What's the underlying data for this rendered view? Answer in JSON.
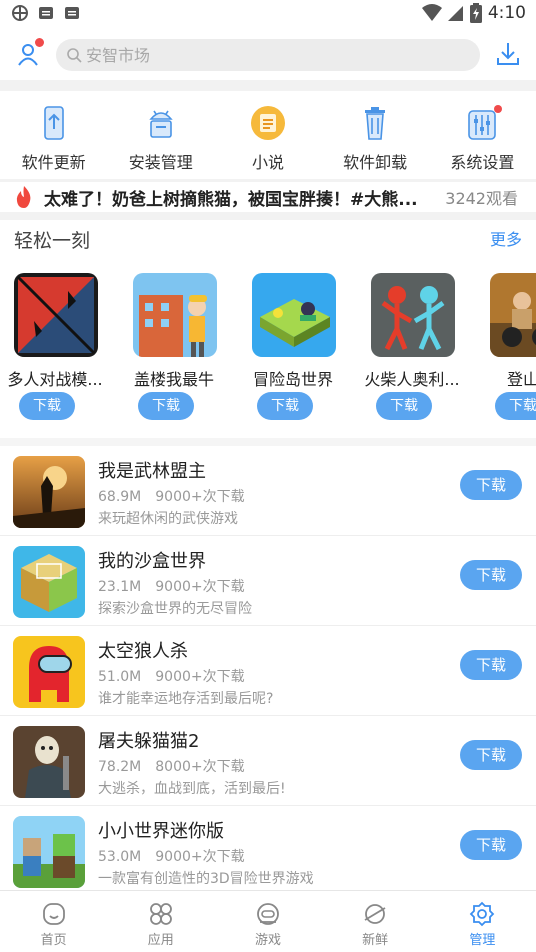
{
  "status_bar": {
    "time": "4:10"
  },
  "search": {
    "placeholder": "安智市场"
  },
  "tools": [
    {
      "label": "软件更新",
      "icon": "phone-update-icon"
    },
    {
      "label": "安装管理",
      "icon": "android-icon"
    },
    {
      "label": "小说",
      "icon": "novel-icon"
    },
    {
      "label": "软件卸载",
      "icon": "trash-icon"
    },
    {
      "label": "系统设置",
      "icon": "settings-icon"
    }
  ],
  "news": {
    "text": "太难了！奶爸上树摘熊猫，被国宝胖揍！#大熊...",
    "views": "3242观看"
  },
  "section": {
    "title": "轻松一刻",
    "more": "更多"
  },
  "featured": [
    {
      "name": "多人对战模...",
      "button": "下载"
    },
    {
      "name": "盖楼我最牛",
      "button": "下载"
    },
    {
      "name": "冒险岛世界",
      "button": "下载"
    },
    {
      "name": "火柴人奥利...",
      "button": "下载"
    },
    {
      "name": "登山越",
      "button": "下载"
    }
  ],
  "apps": [
    {
      "title": "我是武林盟主",
      "size": "68.9M",
      "downloads": "9000+次下载",
      "desc": "来玩超休闲的武侠游戏",
      "button": "下载"
    },
    {
      "title": "我的沙盒世界",
      "size": "23.1M",
      "downloads": "9000+次下载",
      "desc": "探索沙盒世界的无尽冒险",
      "button": "下载"
    },
    {
      "title": "太空狼人杀",
      "size": "51.0M",
      "downloads": "9000+次下载",
      "desc": "谁才能幸运地存活到最后呢?",
      "button": "下载"
    },
    {
      "title": "屠夫躲猫猫2",
      "size": "78.2M",
      "downloads": "8000+次下载",
      "desc": "大逃杀，血战到底，活到最后!",
      "button": "下载"
    },
    {
      "title": "小小世界迷你版",
      "size": "53.0M",
      "downloads": "9000+次下载",
      "desc": "一款富有创造性的3D冒险世界游戏",
      "button": "下载"
    }
  ],
  "tabs": [
    {
      "label": "首页",
      "icon": "home-icon"
    },
    {
      "label": "应用",
      "icon": "apps-icon"
    },
    {
      "label": "游戏",
      "icon": "game-icon"
    },
    {
      "label": "新鲜",
      "icon": "planet-icon"
    },
    {
      "label": "管理",
      "icon": "gear-icon",
      "active": true
    }
  ],
  "colors": {
    "accent": "#3a8ef0",
    "button": "#5aa5f0",
    "badge": "#f04b4b"
  }
}
